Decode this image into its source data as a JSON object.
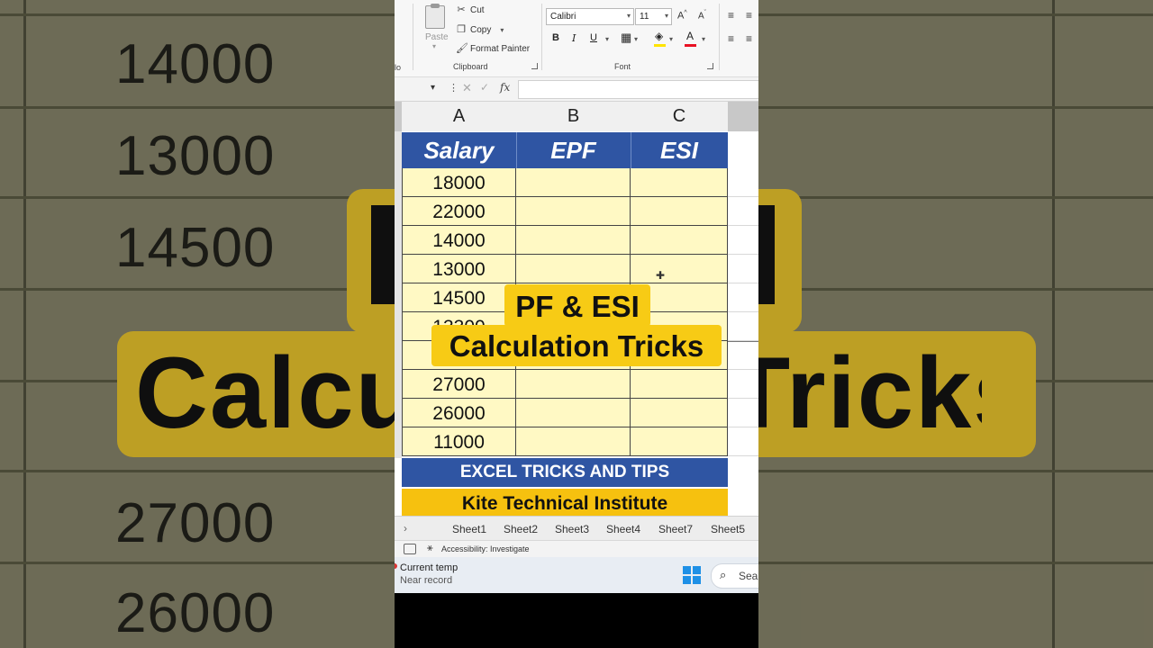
{
  "background": {
    "numbers": [
      "14000",
      "13000",
      "14500",
      "27000",
      "26000"
    ],
    "overlay_text": "Calculation Tricks"
  },
  "ribbon": {
    "clipboard": {
      "paste_label": "Paste",
      "cut_label": "Cut",
      "copy_label": "Copy",
      "format_painter_label": "Format Painter",
      "group_label": "Clipboard"
    },
    "font": {
      "font_name": "Calibri",
      "font_size": "11",
      "grow_label": "A^",
      "shrink_label": "A˅",
      "bold": "B",
      "italic": "I",
      "underline": "U",
      "group_label": "Font",
      "fill_color": "#ffe400",
      "font_color": "#e81123"
    },
    "left_cut_label": "lo"
  },
  "formula_bar": {
    "fx_label": "fx",
    "value": ""
  },
  "sheet": {
    "columns": [
      "A",
      "B",
      "C"
    ],
    "headers": [
      "Salary",
      "EPF",
      "ESI"
    ],
    "salaries": [
      "18000",
      "22000",
      "14000",
      "13000",
      "14500",
      "13300",
      "",
      "27000",
      "26000",
      "11000"
    ],
    "banner_blue": "EXCEL TRICKS AND TIPS",
    "banner_yellow": "Kite Technical Institute",
    "colors": {
      "header_blue": "#2f55a3",
      "cell_yellow": "#fff9c4",
      "banner_yellow": "#f6c10f"
    }
  },
  "overlay": {
    "line1": "PF & ESI",
    "line2": "Calculation Tricks",
    "color": "#f7cb15"
  },
  "tabs": [
    "Sheet1",
    "Sheet2",
    "Sheet3",
    "Sheet4",
    "Sheet7",
    "Sheet5"
  ],
  "status_bar": {
    "accessibility": "Accessibility: Investigate"
  },
  "taskbar": {
    "weather_line1": "Current temp",
    "weather_line2": "Near record",
    "search_placeholder": "Sear"
  }
}
